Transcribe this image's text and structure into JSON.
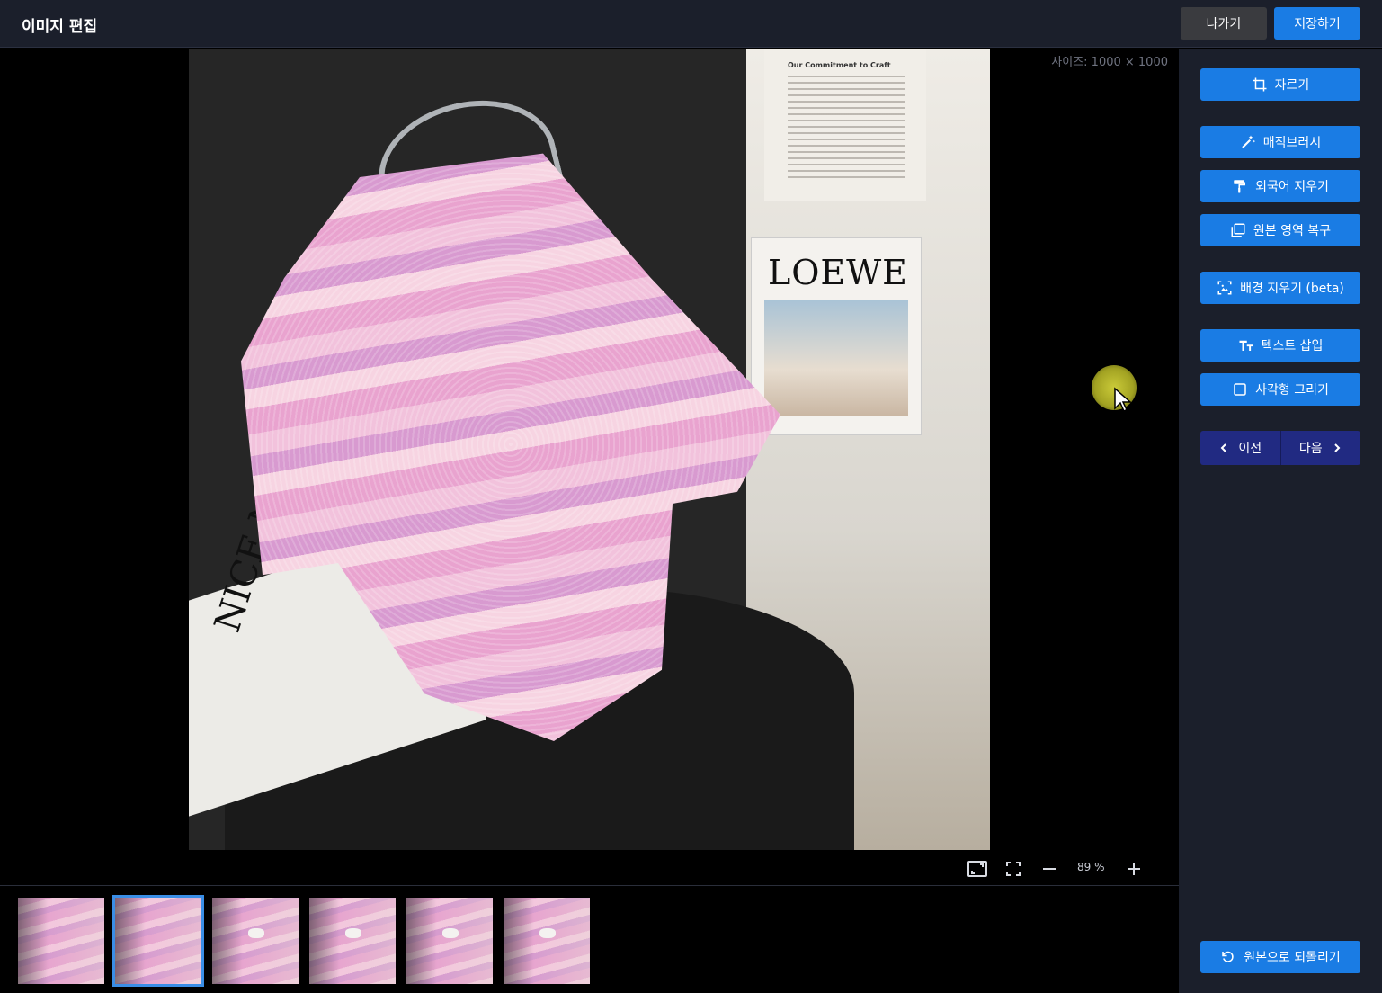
{
  "header": {
    "title": "이미지 편집",
    "exit_label": "나가기",
    "save_label": "저장하기"
  },
  "canvas": {
    "size_label": "사이즈: 1000 × 1000",
    "photo_texts": {
      "magazine_title": "LOEWE",
      "booklet_heading": "Our Commitment to Craft",
      "paper_text": "NICE NIKE NINE"
    }
  },
  "zoom": {
    "value": "89 %"
  },
  "thumbnails": {
    "count": 6,
    "active_index": 1
  },
  "tools": {
    "crop": "자르기",
    "magic_brush": "매직브러시",
    "remove_foreign_text": "외국어 지우기",
    "restore_original_area": "원본 영역 복구",
    "remove_background": "배경 지우기 (beta)",
    "insert_text": "텍스트 삽입",
    "draw_rectangle": "사각형 그리기",
    "prev": "이전",
    "next": "다음",
    "revert": "원본으로 되돌리기"
  },
  "colors": {
    "accent": "#1a7ce4",
    "nav": "#212a82",
    "panel": "#1b1f2b"
  }
}
